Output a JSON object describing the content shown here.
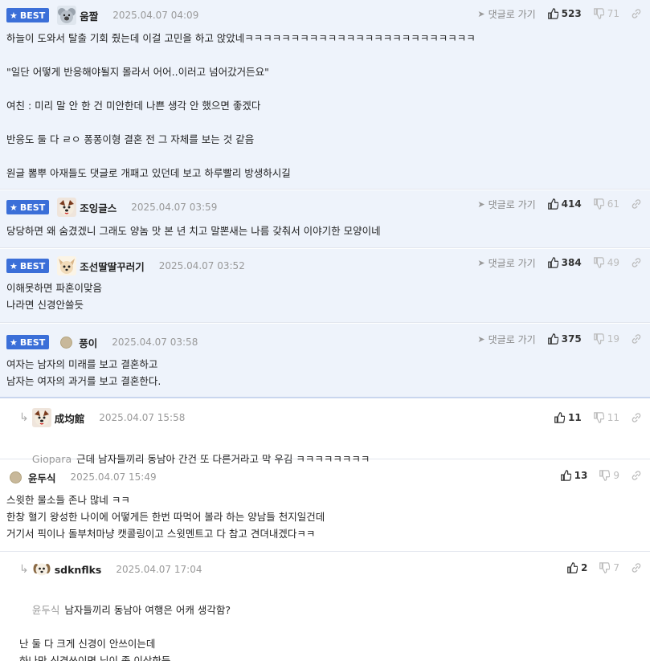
{
  "ui": {
    "best_label": "BEST",
    "reply_label": "댓글로 가기"
  },
  "comments": [
    {
      "best": true,
      "avatar": "koala-avatar",
      "nick": "움짤",
      "date": "2025.04.07 04:09",
      "likes": "523",
      "dislikes": "71",
      "body": "하늘이 도와서 탈출 기회 줬는데 이걸 고민을 하고 앉았네ㅋㅋㅋㅋㅋㅋㅋㅋㅋㅋㅋㅋㅋㅋㅋㅋㅋㅋㅋㅋㅋㅋㅋㅋㅋ\n\n\"일단 어떻게 반응해야될지 몰라서 어어..이러고 넘어갔거든요\"\n\n여친 : 미리 말 안 한 건 미안한데 나쁜 생각 안 했으면 좋겠다\n\n반응도 둘 다 ㄹㅇ 퐁퐁이형 결혼 전 그 자체를 보는 것 같음\n\n원글 뽐뿌 아재들도 댓글로 개패고 있던데 보고 하루빨리 방생하시길"
    },
    {
      "best": true,
      "avatar": "dog-avatar",
      "nick": "조잉글스",
      "date": "2025.04.07 03:59",
      "likes": "414",
      "dislikes": "61",
      "body": "당당하면 왜 숨겼겠니 그래도 양놈 맛 본 년 치고 말뽄새는 나름 갖춰서 이야기한 모양이네"
    },
    {
      "best": true,
      "avatar": "chihuahua-avatar",
      "nick": "조선딸딸꾸러기",
      "date": "2025.04.07 03:52",
      "likes": "384",
      "dislikes": "49",
      "body": "이해못하면 파혼이맞음\n나라면 신경안쓸듯"
    },
    {
      "best": true,
      "avatar": "dot-avatar",
      "nick": "풍이",
      "date": "2025.04.07 03:58",
      "likes": "375",
      "dislikes": "19",
      "body": "여자는 남자의 미래를 보고 결혼하고\n남자는 여자의 과거를 보고 결혼한다."
    },
    {
      "best": false,
      "reply": true,
      "avatar": "dog-avatar",
      "nick": "成均館",
      "date": "2025.04.07 15:58",
      "likes": "11",
      "dislikes": "11",
      "mention": "Giopara",
      "body": "근데 남자들끼리 동남아 간건 또 다른거라고 막 우김 ㅋㅋㅋㅋㅋㅋㅋㅋ"
    },
    {
      "best": false,
      "avatar": "dot-avatar",
      "nick": "윤두식",
      "date": "2025.04.07 15:49",
      "likes": "13",
      "dislikes": "9",
      "body": "스윗한 물소들 존나 많네 ㅋㅋ\n한창 혈기 왕성한 나이에 어떻게든 한번 따먹어 볼라 하는 양남들 천지일건데\n거기서 픽이나 돌부처마냥 캣콜링이고 스윗멘트고 다 참고 견뎌내겠다ㅋㅋ"
    },
    {
      "best": false,
      "reply": true,
      "avatar": "puppy-avatar",
      "nick": "sdknflks",
      "date": "2025.04.07 17:04",
      "likes": "2",
      "dislikes": "7",
      "mention": "윤두식",
      "body": "남자들끼리 동남아 여행은 어캐 생각함?\n\n난 둘 다 크게 신경이 안쓰이는데\n하나만 신경쓰이면 님이 좀 이상한듯"
    }
  ]
}
